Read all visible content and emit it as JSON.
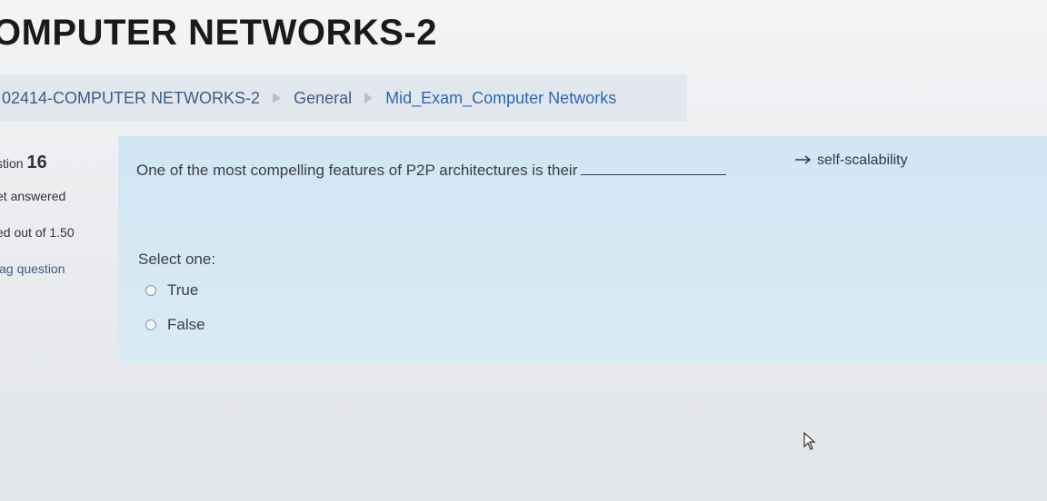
{
  "header": {
    "course_title": "OMPUTER NETWORKS-2"
  },
  "breadcrumb": {
    "items": [
      {
        "label": "02414-COMPUTER NETWORKS-2"
      },
      {
        "label": "General"
      },
      {
        "label": "Mid_Exam_Computer Networks"
      }
    ],
    "separator_icon": "breadcrumb-arrow-icon"
  },
  "question_info": {
    "number_prefix": "stion",
    "number": "16",
    "state": "et answered",
    "grade": "ed out of 1.50",
    "flag_label": "lag question"
  },
  "question": {
    "text": "One of the most compelling features of P2P architectures is their",
    "annotation": "self-scalability",
    "annotation_icon": "arrow-right-icon",
    "prompt": "Select one:",
    "options": [
      {
        "label": "True",
        "checked": false
      },
      {
        "label": "False",
        "checked": false
      }
    ]
  },
  "colors": {
    "breadcrumb_bg": "#e2e7ee",
    "content_bg": "#d2e6f3",
    "link": "#2d67b0"
  }
}
